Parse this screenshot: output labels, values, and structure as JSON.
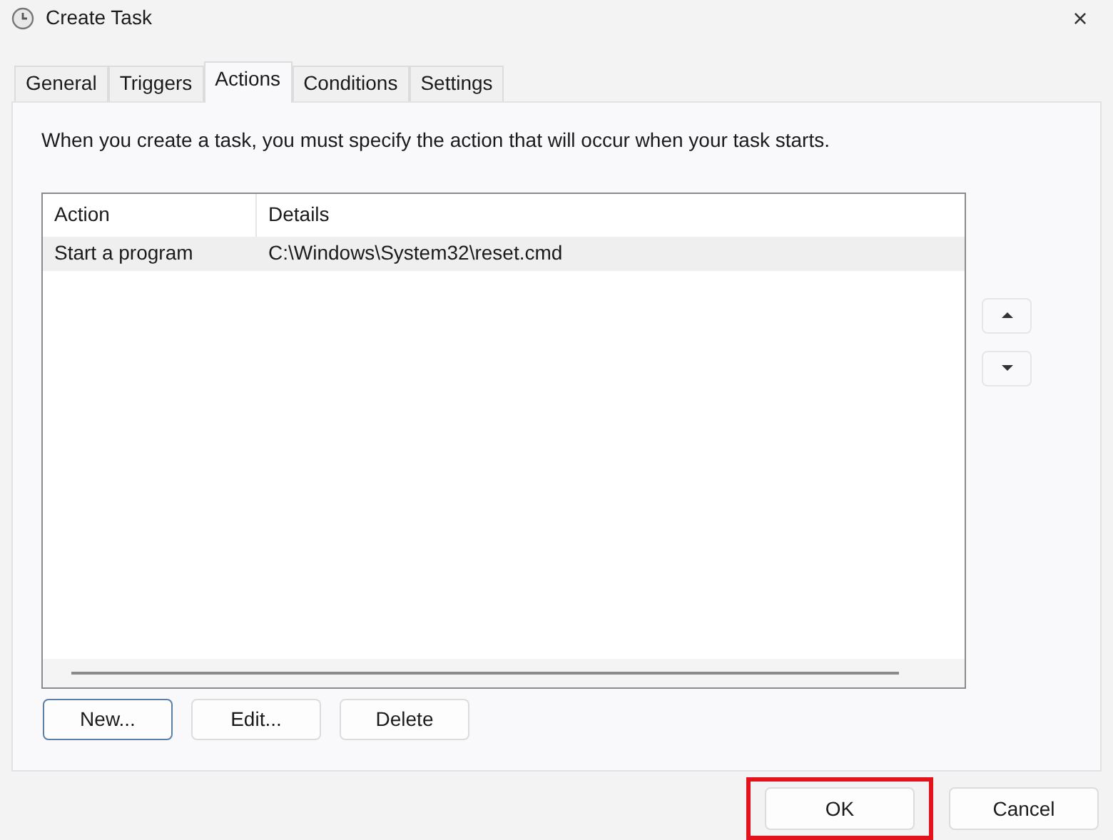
{
  "window": {
    "title": "Create Task",
    "close": "×"
  },
  "tabs": [
    {
      "label": "General",
      "selected": false
    },
    {
      "label": "Triggers",
      "selected": false
    },
    {
      "label": "Actions",
      "selected": true
    },
    {
      "label": "Conditions",
      "selected": false
    },
    {
      "label": "Settings",
      "selected": false
    }
  ],
  "description": "When you create a task, you must specify the action that will occur when your task starts.",
  "table": {
    "columns": [
      "Action",
      "Details"
    ],
    "rows": [
      {
        "cells": [
          "Start a program",
          "C:\\Windows\\System32\\reset.cmd"
        ],
        "selected": true
      }
    ]
  },
  "list_buttons": [
    {
      "label": "New...",
      "focused": true
    },
    {
      "label": "Edit...",
      "focused": false
    },
    {
      "label": "Delete",
      "focused": false
    }
  ],
  "dialog_buttons": [
    {
      "label": "OK",
      "kind": "framed"
    },
    {
      "label": "Cancel",
      "kind": "plain"
    }
  ]
}
